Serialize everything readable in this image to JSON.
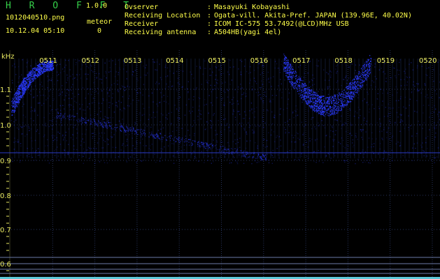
{
  "header": {
    "app_title": "H R O F F T",
    "version": "1.0.0",
    "file_name": "1012040510.png",
    "datetime": "10.12.04 05:10",
    "meteor_label": "meteor",
    "meteor_count": "0",
    "info_rows": [
      {
        "label": "Ovserver",
        "value": "Masayuki Kobayashi"
      },
      {
        "label": "Receiving Location",
        "value": "Ogata-vill. Akita-Pref. JAPAN (139.96E, 40.02N)"
      },
      {
        "label": "Receiver",
        "value": "ICOM IC-575 53.7492(@LCD)MHz USB"
      },
      {
        "label": "Receiving antenna",
        "value": "A504HB(yagi 4el)"
      }
    ]
  },
  "spectrogram": {
    "unit": "kHz",
    "minute_labels": [
      "0511",
      "0512",
      "0513",
      "0514",
      "0515",
      "0516",
      "0517",
      "0518",
      "0519",
      "0520"
    ],
    "y_ticks": [
      "1.1",
      "1.0",
      "0.9",
      "0.8",
      "0.7",
      "0.6"
    ],
    "colors": {
      "background": "#000000",
      "signal": "#2a3aff",
      "grid": "#26325a",
      "tick_text": "#e8e860",
      "minute_text": "#f0f060"
    }
  }
}
